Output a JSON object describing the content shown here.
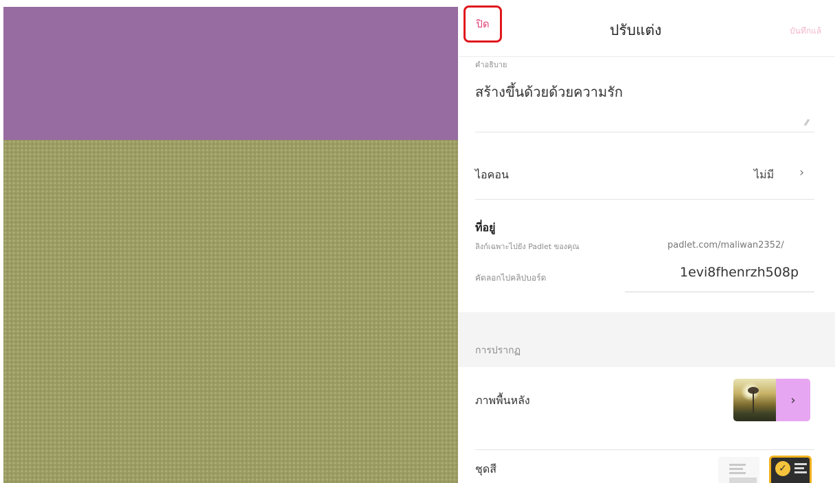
{
  "header": {
    "close_label": "ปิด",
    "title": "ปรับแต่ง",
    "save_label": "บันทึกแล้"
  },
  "description": {
    "label": "คำอธิบาย",
    "value": "สร้างขึ้นด้วยด้วยความรัก"
  },
  "icon_row": {
    "label": "ไอคอน",
    "value": "ไม่มี"
  },
  "address": {
    "title": "ที่อยู่",
    "subtitle": "ลิงก์เฉพาะไปยัง Padlet ของคุณ",
    "copy_label": "คัดลอกไปคลิปบอร์ด",
    "url_prefix": "padlet.com/maliwan2352/",
    "slug": "1evi8fhenrzh508p"
  },
  "appearance": {
    "section_label": "การปรากฏ",
    "background_label": "ภาพพื้นหลัง",
    "color_scheme_label": "ชุดสี"
  },
  "colors": {
    "preview_header": "#966ca1",
    "preview_body": "#9c9d63",
    "accent_pink": "#e0457b",
    "highlight_red": "#e0161b",
    "bg_arrow": "#e7a6f1",
    "selected_theme_border": "#f2b21d"
  },
  "icons": {
    "chevron": "›",
    "check": "✓",
    "resize": "⁄⁄"
  }
}
